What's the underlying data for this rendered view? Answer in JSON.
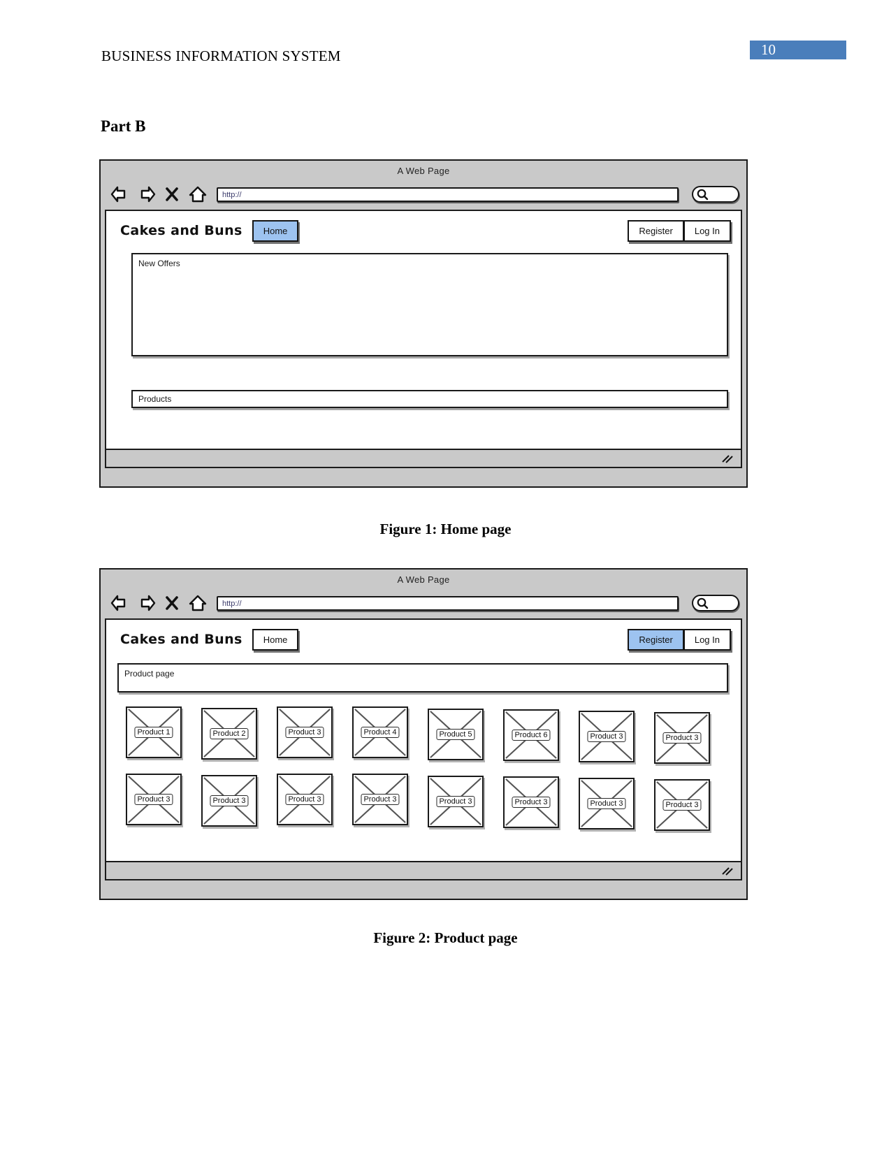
{
  "document": {
    "running_header": "BUSINESS INFORMATION SYSTEM",
    "page_number": "10",
    "section_title": "Part B",
    "page_badge_color": "#4A7EBB"
  },
  "figures": [
    {
      "caption": "Figure 1: Home page",
      "browser": {
        "window_title": "A Web Page",
        "url_value": "http://",
        "icons": {
          "back": "back-arrow-icon",
          "forward": "forward-arrow-icon",
          "stop": "close-x-icon",
          "home": "home-icon",
          "search": "search-icon"
        }
      },
      "site": {
        "brand": "Cakes and Buns",
        "home_label": "Home",
        "home_active": true,
        "register_label": "Register",
        "register_active": false,
        "login_label": "Log In",
        "login_active": false,
        "accent_color": "#9DC3F0"
      },
      "panels": [
        {
          "label": "New Offers"
        },
        {
          "label": "Products"
        }
      ]
    },
    {
      "caption": "Figure 2: Product page",
      "browser": {
        "window_title": "A Web Page",
        "url_value": "http://",
        "icons": {
          "back": "back-arrow-icon",
          "forward": "forward-arrow-icon",
          "stop": "close-x-icon",
          "home": "home-icon",
          "search": "search-icon"
        }
      },
      "site": {
        "brand": "Cakes and Buns",
        "home_label": "Home",
        "home_active": false,
        "register_label": "Register",
        "register_active": true,
        "login_label": "Log In",
        "login_active": false,
        "accent_color": "#9DC3F0"
      },
      "panels": [
        {
          "label": "Product page"
        }
      ],
      "product_grid": {
        "columns": 8,
        "rows": 2,
        "items": [
          "Product 1",
          "Product 2",
          "Product 3",
          "Product 4",
          "Product 5",
          "Product 6",
          "Product 3",
          "Product 3",
          "Product 3",
          "Product 3",
          "Product 3",
          "Product 3",
          "Product 3",
          "Product 3",
          "Product 3",
          "Product 3"
        ]
      }
    }
  ]
}
